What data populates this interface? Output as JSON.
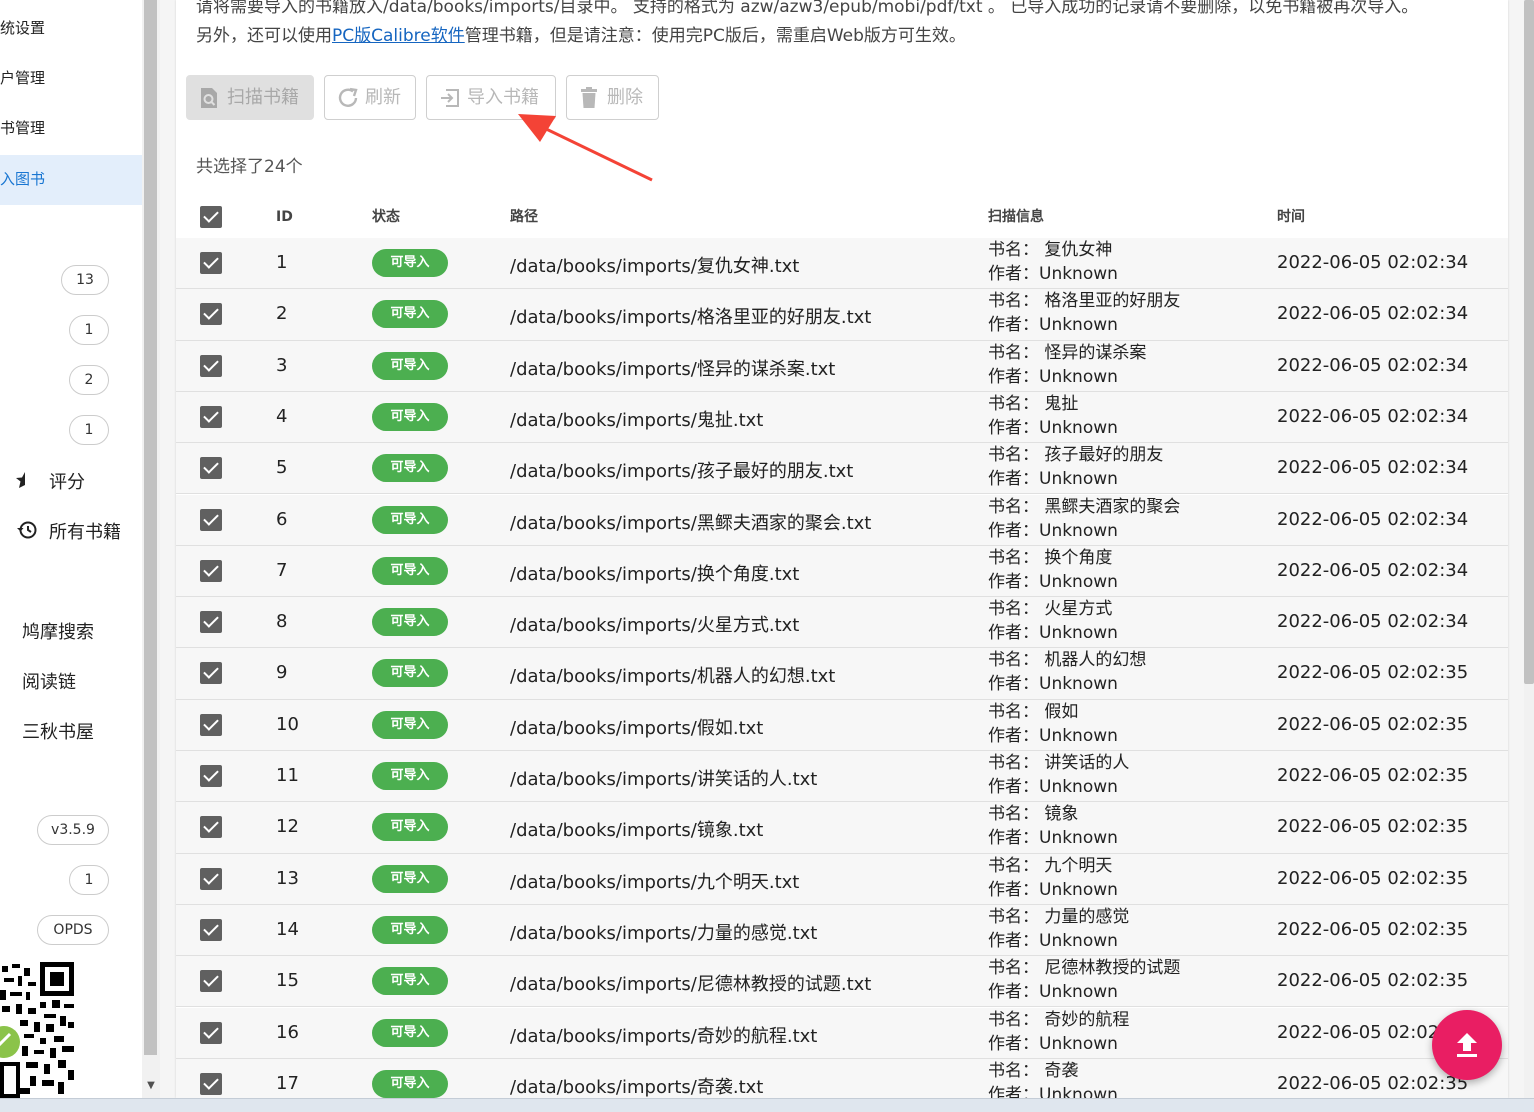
{
  "sidebar": {
    "nav": [
      {
        "label": "统设置"
      },
      {
        "label": "户管理"
      },
      {
        "label": "书管理"
      },
      {
        "label": "入图书",
        "active": true
      }
    ],
    "counts": [
      "13",
      "1",
      "2",
      "1"
    ],
    "menu": [
      {
        "label": "评分",
        "icon": "star-half-icon"
      },
      {
        "label": "所有书籍",
        "icon": "history-icon"
      }
    ],
    "links": [
      "鸠摩搜索",
      "阅读链",
      "三秋书屋"
    ],
    "version": "v3.5.9",
    "version_count": "1",
    "opds": "OPDS"
  },
  "notice": {
    "line1": "请将需要导入的书籍放入/data/books/imports/目录中。 支持的格式为 azw/azw3/epub/mobi/pdf/txt 。 已导入成功的记录请不要删除，以免书籍被再次导入。",
    "line2_before": "另外，还可以使用",
    "line2_link": "PC版Calibre软件",
    "line2_after": "管理书籍，但是请注意：使用完PC版后，需重启Web版方可生效。"
  },
  "toolbar": {
    "scan": "扫描书籍",
    "refresh": "刷新",
    "import": "导入书籍",
    "delete": "删除"
  },
  "selection": "共选择了24个",
  "table": {
    "headers": {
      "id": "ID",
      "status": "状态",
      "path": "路径",
      "scan": "扫描信息",
      "time": "时间"
    },
    "title_prefix": "书名：",
    "author_prefix": "作者：",
    "rows": [
      {
        "id": "1",
        "status": "可导入",
        "path": "/data/books/imports/复仇女神.txt",
        "title": "复仇女神",
        "author": "Unknown",
        "time": "2022-06-05 02:02:34"
      },
      {
        "id": "2",
        "status": "可导入",
        "path": "/data/books/imports/格洛里亚的好朋友.txt",
        "title": "格洛里亚的好朋友",
        "author": "Unknown",
        "time": "2022-06-05 02:02:34"
      },
      {
        "id": "3",
        "status": "可导入",
        "path": "/data/books/imports/怪异的谋杀案.txt",
        "title": "怪异的谋杀案",
        "author": "Unknown",
        "time": "2022-06-05 02:02:34"
      },
      {
        "id": "4",
        "status": "可导入",
        "path": "/data/books/imports/鬼扯.txt",
        "title": "鬼扯",
        "author": "Unknown",
        "time": "2022-06-05 02:02:34"
      },
      {
        "id": "5",
        "status": "可导入",
        "path": "/data/books/imports/孩子最好的朋友.txt",
        "title": "孩子最好的朋友",
        "author": "Unknown",
        "time": "2022-06-05 02:02:34"
      },
      {
        "id": "6",
        "status": "可导入",
        "path": "/data/books/imports/黑鳏夫酒家的聚会.txt",
        "title": "黑鳏夫酒家的聚会",
        "author": "Unknown",
        "time": "2022-06-05 02:02:34"
      },
      {
        "id": "7",
        "status": "可导入",
        "path": "/data/books/imports/换个角度.txt",
        "title": "换个角度",
        "author": "Unknown",
        "time": "2022-06-05 02:02:34"
      },
      {
        "id": "8",
        "status": "可导入",
        "path": "/data/books/imports/火星方式.txt",
        "title": "火星方式",
        "author": "Unknown",
        "time": "2022-06-05 02:02:34"
      },
      {
        "id": "9",
        "status": "可导入",
        "path": "/data/books/imports/机器人的幻想.txt",
        "title": "机器人的幻想",
        "author": "Unknown",
        "time": "2022-06-05 02:02:35"
      },
      {
        "id": "10",
        "status": "可导入",
        "path": "/data/books/imports/假如.txt",
        "title": "假如",
        "author": "Unknown",
        "time": "2022-06-05 02:02:35"
      },
      {
        "id": "11",
        "status": "可导入",
        "path": "/data/books/imports/讲笑话的人.txt",
        "title": "讲笑话的人",
        "author": "Unknown",
        "time": "2022-06-05 02:02:35"
      },
      {
        "id": "12",
        "status": "可导入",
        "path": "/data/books/imports/镜象.txt",
        "title": "镜象",
        "author": "Unknown",
        "time": "2022-06-05 02:02:35"
      },
      {
        "id": "13",
        "status": "可导入",
        "path": "/data/books/imports/九个明天.txt",
        "title": "九个明天",
        "author": "Unknown",
        "time": "2022-06-05 02:02:35"
      },
      {
        "id": "14",
        "status": "可导入",
        "path": "/data/books/imports/力量的感觉.txt",
        "title": "力量的感觉",
        "author": "Unknown",
        "time": "2022-06-05 02:02:35"
      },
      {
        "id": "15",
        "status": "可导入",
        "path": "/data/books/imports/尼德林教授的试题.txt",
        "title": "尼德林教授的试题",
        "author": "Unknown",
        "time": "2022-06-05 02:02:35"
      },
      {
        "id": "16",
        "status": "可导入",
        "path": "/data/books/imports/奇妙的航程.txt",
        "title": "奇妙的航程",
        "author": "Unknown",
        "time": "2022-06-05 02:02:35"
      },
      {
        "id": "17",
        "status": "可导入",
        "path": "/data/books/imports/奇袭.txt",
        "title": "奇袭",
        "author": "Unknown",
        "time": "2022-06-05 02:02:35"
      }
    ]
  },
  "colors": {
    "accent": "#1976d2",
    "badge": "#4caf50",
    "fab": "#e91e63",
    "annotation_arrow": "#f44336"
  }
}
